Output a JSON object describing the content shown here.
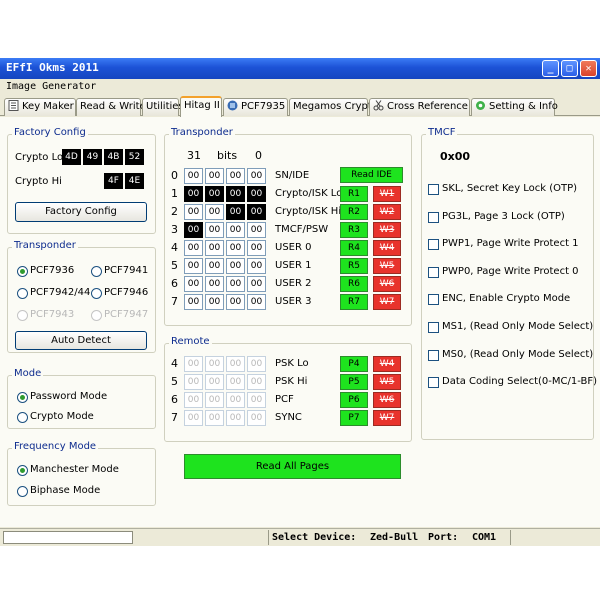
{
  "title": "EFfI  Okms 2011",
  "title_buttons": [
    "_",
    "□",
    "✕"
  ],
  "menu": "Image Generator",
  "tabs": [
    {
      "label": "Key Maker",
      "icon": "document-icon"
    },
    {
      "label": "Read & Write"
    },
    {
      "label": "Utilities"
    },
    {
      "label": "Hitag II",
      "active": true
    },
    {
      "label": "PCF7935",
      "icon": "chip-icon"
    },
    {
      "label": "Megamos Crypto"
    },
    {
      "label": "Cross Reference",
      "icon": "scissors-icon"
    },
    {
      "label": "Setting & Info",
      "icon": "gear-icon"
    }
  ],
  "factory_config": {
    "title": "Factory Config",
    "crypto_lo_label": "Crypto Lo",
    "crypto_lo": [
      "4D",
      "49",
      "4B",
      "52"
    ],
    "crypto_hi_label": "Crypto Hi",
    "crypto_hi": [
      "4F",
      "4E"
    ],
    "button": "Factory Config"
  },
  "transponder_select": {
    "title": "Transponder",
    "options": [
      "PCF7936",
      "PCF7941",
      "PCF7942/44",
      "PCF7946",
      "PCF7943",
      "PCF7947"
    ],
    "button": "Auto Detect"
  },
  "mode": {
    "title": "Mode",
    "options": [
      "Password Mode",
      "Crypto Mode"
    ]
  },
  "frequency": {
    "title": "Frequency Mode",
    "options": [
      "Manchester Mode",
      "Biphase Mode"
    ]
  },
  "transponder_pages": {
    "title": "Transponder",
    "bits_left": "31",
    "bits_label": "bits",
    "bits_right": "0",
    "read_ide": "Read IDE",
    "rows": [
      {
        "num": "0",
        "cells": [
          "00",
          "00",
          "00",
          "00"
        ],
        "label": "SN/IDE"
      },
      {
        "num": "1",
        "cells": [
          "00",
          "00",
          "00",
          "00"
        ],
        "label": "Crypto/ISK Lo",
        "r": "R1",
        "w": "W1"
      },
      {
        "num": "2",
        "cells": [
          "00",
          "00",
          "00",
          "00"
        ],
        "label": "Crypto/ISK Hi",
        "r": "R2",
        "w": "W2"
      },
      {
        "num": "3",
        "cells": [
          "00",
          "00",
          "00",
          "00"
        ],
        "label": "TMCF/PSW",
        "r": "R3",
        "w": "W3"
      },
      {
        "num": "4",
        "cells": [
          "00",
          "00",
          "00",
          "00"
        ],
        "label": "USER 0",
        "r": "R4",
        "w": "W4"
      },
      {
        "num": "5",
        "cells": [
          "00",
          "00",
          "00",
          "00"
        ],
        "label": "USER 1",
        "r": "R5",
        "w": "W5"
      },
      {
        "num": "6",
        "cells": [
          "00",
          "00",
          "00",
          "00"
        ],
        "label": "USER 2",
        "r": "R6",
        "w": "W6"
      },
      {
        "num": "7",
        "cells": [
          "00",
          "00",
          "00",
          "00"
        ],
        "label": "USER 3",
        "r": "R7",
        "w": "W7"
      }
    ]
  },
  "remote": {
    "title": "Remote",
    "rows": [
      {
        "num": "4",
        "cells": [
          "00",
          "00",
          "00",
          "00"
        ],
        "label": "PSK Lo",
        "r": "P4",
        "w": "W4"
      },
      {
        "num": "5",
        "cells": [
          "00",
          "00",
          "00",
          "00"
        ],
        "label": "PSK Hi",
        "r": "P5",
        "w": "W5"
      },
      {
        "num": "6",
        "cells": [
          "00",
          "00",
          "00",
          "00"
        ],
        "label": "PCF",
        "r": "P6",
        "w": "W6"
      },
      {
        "num": "7",
        "cells": [
          "00",
          "00",
          "00",
          "00"
        ],
        "label": "SYNC",
        "r": "P7",
        "w": "W7"
      }
    ]
  },
  "read_all": "Read All Pages",
  "tmcf": {
    "title": "TMCF",
    "value": "0x00",
    "options": [
      "SKL, Secret Key Lock (OTP)",
      "PG3L, Page 3 Lock (OTP)",
      "PWP1, Page Write Protect 1",
      "PWP0, Page Write Protect 0",
      "ENC, Enable Crypto Mode",
      "MS1, (Read Only Mode Select)",
      "MS0, (Read Only Mode Select)",
      "Data Coding Select(0-MC/1-BF)"
    ]
  },
  "status": {
    "select_device_label": "Select Device:",
    "device": "Zed-Bull",
    "port_label": "Port:",
    "port": "COM1"
  },
  "colors": {
    "accent_green": "#1ee31e",
    "accent_red": "#e8332c",
    "title_blue": "#1c52d6",
    "group_title": "#0e2c8e"
  }
}
